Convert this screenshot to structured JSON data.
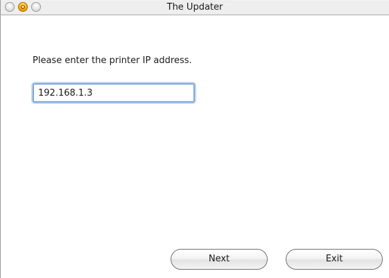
{
  "window": {
    "title": "The Updater"
  },
  "form": {
    "prompt": "Please enter the printer IP address.",
    "ip_value": "192.168.1.3"
  },
  "buttons": {
    "next_label": "Next",
    "exit_label": "Exit"
  },
  "colors": {
    "focus_ring": "#7ea6d8",
    "minimize_button": "#f7c21f"
  }
}
